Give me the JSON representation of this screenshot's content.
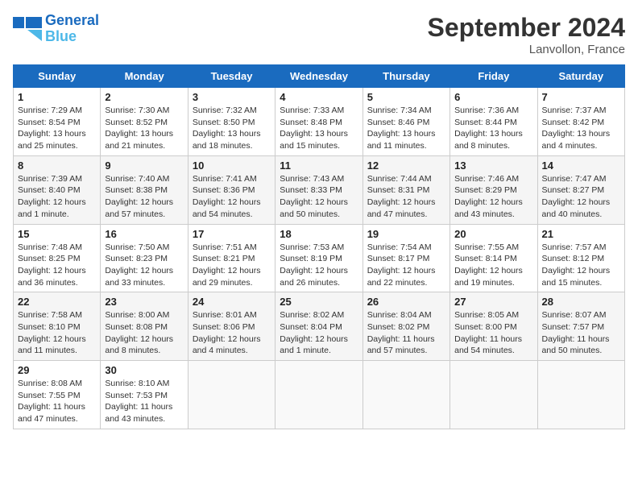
{
  "header": {
    "logo_line1": "General",
    "logo_line2": "Blue",
    "month": "September 2024",
    "location": "Lanvollon, France"
  },
  "days_of_week": [
    "Sunday",
    "Monday",
    "Tuesday",
    "Wednesday",
    "Thursday",
    "Friday",
    "Saturday"
  ],
  "weeks": [
    [
      {
        "day": "1",
        "sunrise": "7:29 AM",
        "sunset": "8:54 PM",
        "daylight": "13 hours and 25 minutes."
      },
      {
        "day": "2",
        "sunrise": "7:30 AM",
        "sunset": "8:52 PM",
        "daylight": "13 hours and 21 minutes."
      },
      {
        "day": "3",
        "sunrise": "7:32 AM",
        "sunset": "8:50 PM",
        "daylight": "13 hours and 18 minutes."
      },
      {
        "day": "4",
        "sunrise": "7:33 AM",
        "sunset": "8:48 PM",
        "daylight": "13 hours and 15 minutes."
      },
      {
        "day": "5",
        "sunrise": "7:34 AM",
        "sunset": "8:46 PM",
        "daylight": "13 hours and 11 minutes."
      },
      {
        "day": "6",
        "sunrise": "7:36 AM",
        "sunset": "8:44 PM",
        "daylight": "13 hours and 8 minutes."
      },
      {
        "day": "7",
        "sunrise": "7:37 AM",
        "sunset": "8:42 PM",
        "daylight": "13 hours and 4 minutes."
      }
    ],
    [
      {
        "day": "8",
        "sunrise": "7:39 AM",
        "sunset": "8:40 PM",
        "daylight": "12 hours and 1 minute."
      },
      {
        "day": "9",
        "sunrise": "7:40 AM",
        "sunset": "8:38 PM",
        "daylight": "12 hours and 57 minutes."
      },
      {
        "day": "10",
        "sunrise": "7:41 AM",
        "sunset": "8:36 PM",
        "daylight": "12 hours and 54 minutes."
      },
      {
        "day": "11",
        "sunrise": "7:43 AM",
        "sunset": "8:33 PM",
        "daylight": "12 hours and 50 minutes."
      },
      {
        "day": "12",
        "sunrise": "7:44 AM",
        "sunset": "8:31 PM",
        "daylight": "12 hours and 47 minutes."
      },
      {
        "day": "13",
        "sunrise": "7:46 AM",
        "sunset": "8:29 PM",
        "daylight": "12 hours and 43 minutes."
      },
      {
        "day": "14",
        "sunrise": "7:47 AM",
        "sunset": "8:27 PM",
        "daylight": "12 hours and 40 minutes."
      }
    ],
    [
      {
        "day": "15",
        "sunrise": "7:48 AM",
        "sunset": "8:25 PM",
        "daylight": "12 hours and 36 minutes."
      },
      {
        "day": "16",
        "sunrise": "7:50 AM",
        "sunset": "8:23 PM",
        "daylight": "12 hours and 33 minutes."
      },
      {
        "day": "17",
        "sunrise": "7:51 AM",
        "sunset": "8:21 PM",
        "daylight": "12 hours and 29 minutes."
      },
      {
        "day": "18",
        "sunrise": "7:53 AM",
        "sunset": "8:19 PM",
        "daylight": "12 hours and 26 minutes."
      },
      {
        "day": "19",
        "sunrise": "7:54 AM",
        "sunset": "8:17 PM",
        "daylight": "12 hours and 22 minutes."
      },
      {
        "day": "20",
        "sunrise": "7:55 AM",
        "sunset": "8:14 PM",
        "daylight": "12 hours and 19 minutes."
      },
      {
        "day": "21",
        "sunrise": "7:57 AM",
        "sunset": "8:12 PM",
        "daylight": "12 hours and 15 minutes."
      }
    ],
    [
      {
        "day": "22",
        "sunrise": "7:58 AM",
        "sunset": "8:10 PM",
        "daylight": "12 hours and 11 minutes."
      },
      {
        "day": "23",
        "sunrise": "8:00 AM",
        "sunset": "8:08 PM",
        "daylight": "12 hours and 8 minutes."
      },
      {
        "day": "24",
        "sunrise": "8:01 AM",
        "sunset": "8:06 PM",
        "daylight": "12 hours and 4 minutes."
      },
      {
        "day": "25",
        "sunrise": "8:02 AM",
        "sunset": "8:04 PM",
        "daylight": "12 hours and 1 minute."
      },
      {
        "day": "26",
        "sunrise": "8:04 AM",
        "sunset": "8:02 PM",
        "daylight": "11 hours and 57 minutes."
      },
      {
        "day": "27",
        "sunrise": "8:05 AM",
        "sunset": "8:00 PM",
        "daylight": "11 hours and 54 minutes."
      },
      {
        "day": "28",
        "sunrise": "8:07 AM",
        "sunset": "7:57 PM",
        "daylight": "11 hours and 50 minutes."
      }
    ],
    [
      {
        "day": "29",
        "sunrise": "8:08 AM",
        "sunset": "7:55 PM",
        "daylight": "11 hours and 47 minutes."
      },
      {
        "day": "30",
        "sunrise": "8:10 AM",
        "sunset": "7:53 PM",
        "daylight": "11 hours and 43 minutes."
      },
      null,
      null,
      null,
      null,
      null
    ]
  ]
}
